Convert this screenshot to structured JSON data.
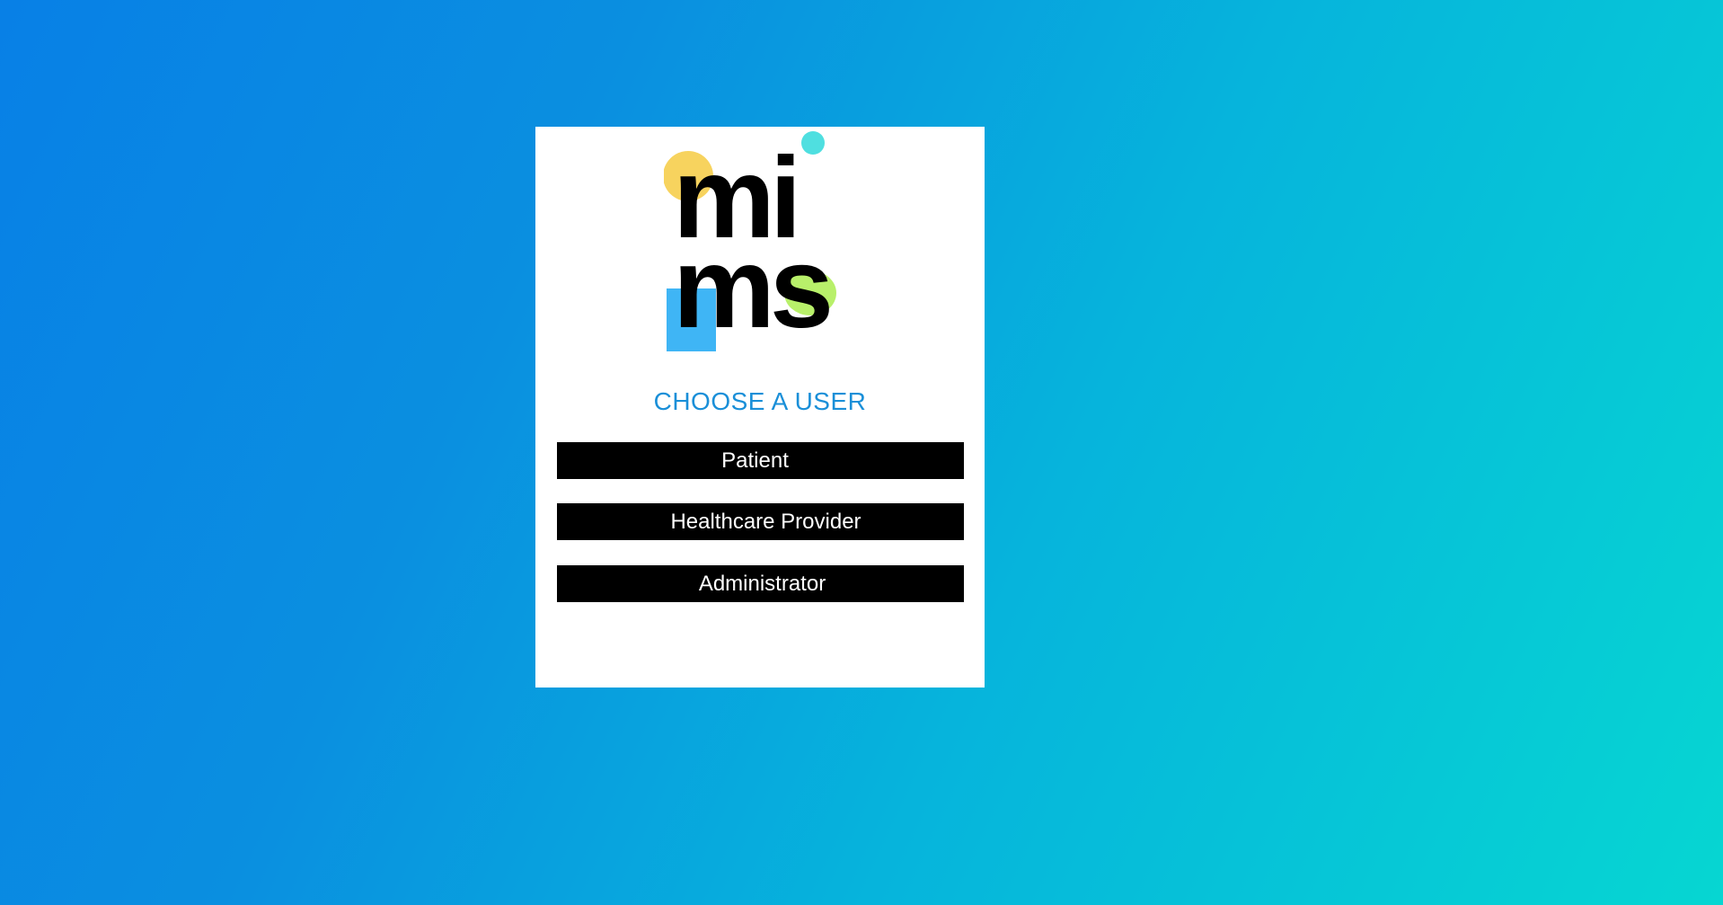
{
  "logo": {
    "line1": "mi",
    "line2": "ms",
    "colors": {
      "yellow_circle": "#f7d35e",
      "teal_dot": "#4fdfe0",
      "blue_square": "#3fb5f5",
      "green_blob": "#b8f06a",
      "text": "#000000"
    }
  },
  "heading": "CHOOSE A USER",
  "buttons": {
    "patient": "Patient",
    "provider": "Healthcare Provider",
    "admin": "Administrator"
  },
  "colors": {
    "background_start": "#0880e6",
    "background_end": "#06d6d2",
    "heading": "#1a8fd8",
    "button_bg": "#000000",
    "button_text": "#ffffff"
  }
}
